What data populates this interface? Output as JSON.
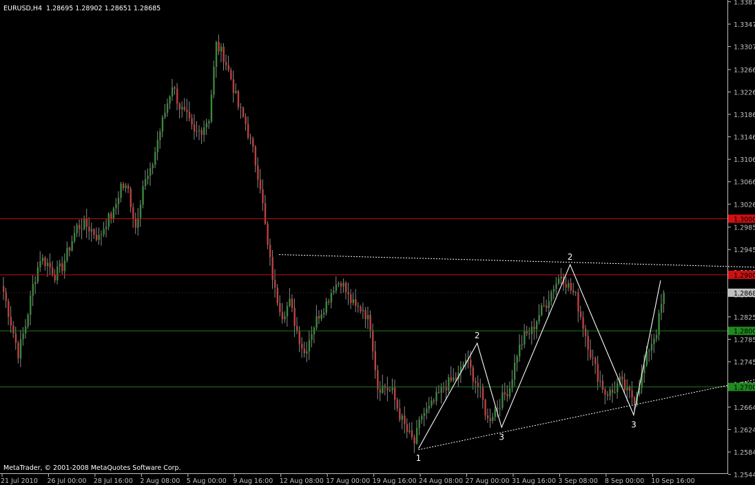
{
  "header": {
    "title": "EURUSD,H4",
    "ohlc": "1.28695 1.28902 1.28651 1.28685"
  },
  "footer": {
    "copyright": "MetaTrader, © 2001-2008 MetaQuotes Software Corp."
  },
  "colors": {
    "background": "#000000",
    "axis": "#c0c0c0",
    "bull_candle": "#3a8a3a",
    "bear_candle": "#c04040",
    "resistance_line": "#c01010",
    "support_line": "#1f7a1f",
    "pattern_line": "#ffffff",
    "current_price_bg": "#c0c0c0",
    "red_label_bg": "#d01010",
    "green_label_bg": "#1f8a1f"
  },
  "chart_data": {
    "type": "candlestick",
    "symbol": "EURUSD",
    "timeframe": "H4",
    "ylim": [
      1.2546,
      1.339
    ],
    "y_ticks": [
      "1.33870",
      "1.33470",
      "1.33070",
      "1.32660",
      "1.32260",
      "1.31860",
      "1.31460",
      "1.31060",
      "1.30660",
      "1.30260",
      "1.29850",
      "1.29450",
      "1.29050",
      "1.28650",
      "1.28250",
      "1.27850",
      "1.27450",
      "1.27050",
      "1.26640",
      "1.26240",
      "1.25840",
      "1.25440"
    ],
    "x_ticks": [
      "21 Jul 2010",
      "26 Jul 00:00",
      "28 Jul 16:00",
      "2 Aug 08:00",
      "5 Aug 00:00",
      "9 Aug 16:00",
      "12 Aug 08:00",
      "17 Aug 00:00",
      "19 Aug 16:00",
      "24 Aug 08:00",
      "27 Aug 00:00",
      "31 Aug 16:00",
      "3 Sep 08:00",
      "8 Sep 00:00",
      "10 Sep 16:00"
    ],
    "close_path": [
      [
        0,
        1.287
      ],
      [
        3,
        1.2815
      ],
      [
        6,
        1.276
      ],
      [
        9,
        1.281
      ],
      [
        12,
        1.288
      ],
      [
        15,
        1.293
      ],
      [
        18,
        1.292
      ],
      [
        21,
        1.29
      ],
      [
        24,
        1.2915
      ],
      [
        27,
        1.295
      ],
      [
        30,
        1.2985
      ],
      [
        33,
        1.299
      ],
      [
        36,
        1.298
      ],
      [
        39,
        1.2965
      ],
      [
        42,
        1.2995
      ],
      [
        45,
        1.301
      ],
      [
        48,
        1.306
      ],
      [
        51,
        1.305
      ],
      [
        54,
        1.2985
      ],
      [
        57,
        1.306
      ],
      [
        60,
        1.308
      ],
      [
        63,
        1.314
      ],
      [
        66,
        1.319
      ],
      [
        69,
        1.324
      ],
      [
        72,
        1.32
      ],
      [
        75,
        1.318
      ],
      [
        78,
        1.315
      ],
      [
        81,
        1.316
      ],
      [
        84,
        1.318
      ],
      [
        87,
        1.331
      ],
      [
        90,
        1.329
      ],
      [
        93,
        1.325
      ],
      [
        96,
        1.32
      ],
      [
        99,
        1.317
      ],
      [
        102,
        1.312
      ],
      [
        105,
        1.306
      ],
      [
        108,
        1.295
      ],
      [
        111,
        1.287
      ],
      [
        114,
        1.283
      ],
      [
        117,
        1.285
      ],
      [
        120,
        1.28
      ],
      [
        123,
        1.276
      ],
      [
        126,
        1.28
      ],
      [
        129,
        1.283
      ],
      [
        132,
        1.285
      ],
      [
        135,
        1.288
      ],
      [
        138,
        1.289
      ],
      [
        141,
        1.286
      ],
      [
        144,
        1.284
      ],
      [
        147,
        1.284
      ],
      [
        150,
        1.281
      ],
      [
        153,
        1.27
      ],
      [
        156,
        1.27
      ],
      [
        159,
        1.269
      ],
      [
        162,
        1.265
      ],
      [
        165,
        1.262
      ],
      [
        168,
        1.26
      ],
      [
        171,
        1.265
      ],
      [
        174,
        1.266
      ],
      [
        177,
        1.268
      ],
      [
        180,
        1.27
      ],
      [
        183,
        1.271
      ],
      [
        186,
        1.272
      ],
      [
        189,
        1.275
      ],
      [
        192,
        1.272
      ],
      [
        195,
        1.269
      ],
      [
        198,
        1.264
      ],
      [
        201,
        1.266
      ],
      [
        204,
        1.268
      ],
      [
        207,
        1.27
      ],
      [
        210,
        1.276
      ],
      [
        213,
        1.279
      ],
      [
        216,
        1.28
      ],
      [
        219,
        1.283
      ],
      [
        222,
        1.285
      ],
      [
        225,
        1.288
      ],
      [
        228,
        1.29
      ],
      [
        231,
        1.288
      ],
      [
        234,
        1.286
      ],
      [
        237,
        1.281
      ],
      [
        240,
        1.276
      ],
      [
        243,
        1.272
      ],
      [
        246,
        1.269
      ],
      [
        249,
        1.269
      ],
      [
        252,
        1.271
      ],
      [
        255,
        1.269
      ],
      [
        258,
        1.268
      ],
      [
        261,
        1.272
      ],
      [
        264,
        1.277
      ],
      [
        267,
        1.28
      ],
      [
        270,
        1.2868
      ]
    ],
    "horizontal_lines": [
      {
        "price": 1.3,
        "label": "1.30000",
        "kind": "resistance"
      },
      {
        "price": 1.29,
        "label": "1.29000",
        "kind": "resistance"
      },
      {
        "price": 1.28,
        "label": "1.28000",
        "kind": "support"
      },
      {
        "price": 1.27,
        "label": "1.27000",
        "kind": "support"
      }
    ],
    "current_price_label": "1.28685",
    "trendlines": [
      {
        "style": "dashed",
        "from": [
          113,
          1.2936
        ],
        "to": [
          312,
          1.2913
        ]
      },
      {
        "style": "dashed",
        "from": [
          170,
          1.2588
        ],
        "to": [
          312,
          1.2717
        ]
      }
    ],
    "pattern": {
      "points": [
        [
          170,
          1.259
        ],
        [
          194,
          1.2778
        ],
        [
          204,
          1.2628
        ],
        [
          232,
          1.2918
        ],
        [
          258,
          1.265
        ],
        [
          269,
          1.289
        ]
      ],
      "labels": [
        {
          "text": "1",
          "at": [
            170,
            1.259
          ],
          "pos": "below"
        },
        {
          "text": "2",
          "at": [
            194,
            1.2778
          ],
          "pos": "above"
        },
        {
          "text": "3",
          "at": [
            204,
            1.2628
          ],
          "pos": "below"
        },
        {
          "text": "2",
          "at": [
            232,
            1.2918
          ],
          "pos": "above"
        },
        {
          "text": "3",
          "at": [
            258,
            1.265
          ],
          "pos": "below"
        }
      ]
    }
  }
}
